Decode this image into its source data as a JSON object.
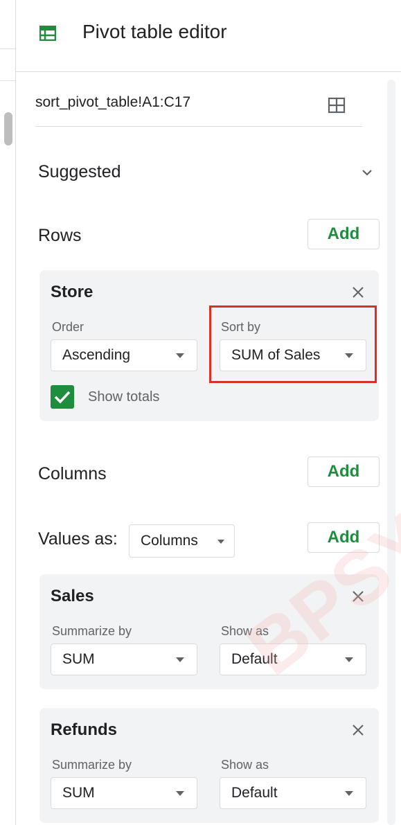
{
  "header": {
    "title": "Pivot table editor",
    "logo_icon": "pivot-table-icon",
    "accent": "#1e8e3e"
  },
  "range": {
    "value": "sort_pivot_table!A1:C17",
    "select_icon": "grid-icon"
  },
  "suggested": {
    "label": "Suggested",
    "icon": "chevron-down-icon"
  },
  "rows": {
    "label": "Rows",
    "add_label": "Add",
    "card": {
      "title": "Store",
      "order_label": "Order",
      "order_value": "Ascending",
      "sort_label": "Sort by",
      "sort_value": "SUM of Sales",
      "show_totals_label": "Show totals",
      "show_totals_checked": true
    }
  },
  "columns": {
    "label": "Columns",
    "add_label": "Add"
  },
  "values": {
    "label": "Values as:",
    "mode": "Columns",
    "add_label": "Add",
    "cards": [
      {
        "title": "Sales",
        "summarize_label": "Summarize by",
        "summarize_value": "SUM",
        "show_as_label": "Show as",
        "show_as_value": "Default"
      },
      {
        "title": "Refunds",
        "summarize_label": "Summarize by",
        "summarize_value": "SUM",
        "show_as_label": "Show as",
        "show_as_value": "Default"
      }
    ]
  },
  "highlight_color": "#d93025",
  "watermark": "BPSY"
}
